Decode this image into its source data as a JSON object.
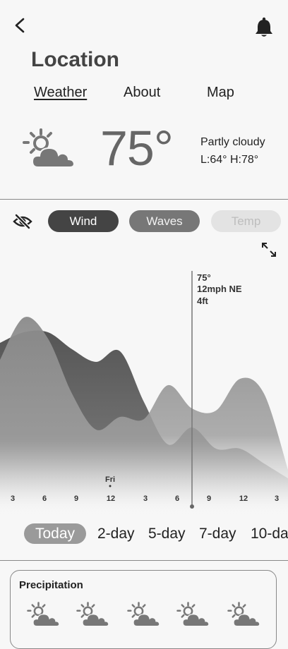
{
  "header": {
    "title": "Location"
  },
  "tabs": [
    {
      "label": "Weather",
      "active": true
    },
    {
      "label": "About",
      "active": false
    },
    {
      "label": "Map",
      "active": false
    }
  ],
  "current": {
    "temperature": "75°",
    "condition": "Partly cloudy",
    "low_high": "L:64° H:78°",
    "icon": "sun-cloud-icon"
  },
  "layers": [
    {
      "label": "Wind",
      "state": "active"
    },
    {
      "label": "Waves",
      "state": "active"
    },
    {
      "label": "Temp",
      "state": "disabled"
    }
  ],
  "chart_data": {
    "type": "area",
    "x_ticks": [
      "3",
      "6",
      "9",
      "12",
      "3",
      "6",
      "9",
      "12",
      "3"
    ],
    "day_marker": {
      "label": "Fri",
      "at_tick": "12"
    },
    "cursor": {
      "temp": "75°",
      "wind": "12mph NE",
      "waves": "4ft"
    },
    "series": [
      {
        "values": [
          6.8,
          7.3,
          7.3,
          6.5,
          5.9,
          6.4,
          4.0,
          2.0,
          2.8,
          1.8,
          1.8,
          1.1,
          0.4
        ],
        "color": "#555555"
      },
      {
        "values": [
          6.0,
          8.0,
          7.0,
          4.4,
          2.7,
          3.3,
          3.2,
          4.8,
          3.7,
          3.6,
          5.1,
          4.4,
          0.8
        ],
        "color": "#8a8a8a"
      }
    ]
  },
  "ranges": [
    {
      "label": "Today",
      "active": true
    },
    {
      "label": "2-day",
      "active": false
    },
    {
      "label": "5-day",
      "active": false
    },
    {
      "label": "7-day",
      "active": false
    },
    {
      "label": "10-day",
      "active": false
    }
  ],
  "precipitation": {
    "title": "Precipitation",
    "icon": "sun-cloud-icon"
  }
}
